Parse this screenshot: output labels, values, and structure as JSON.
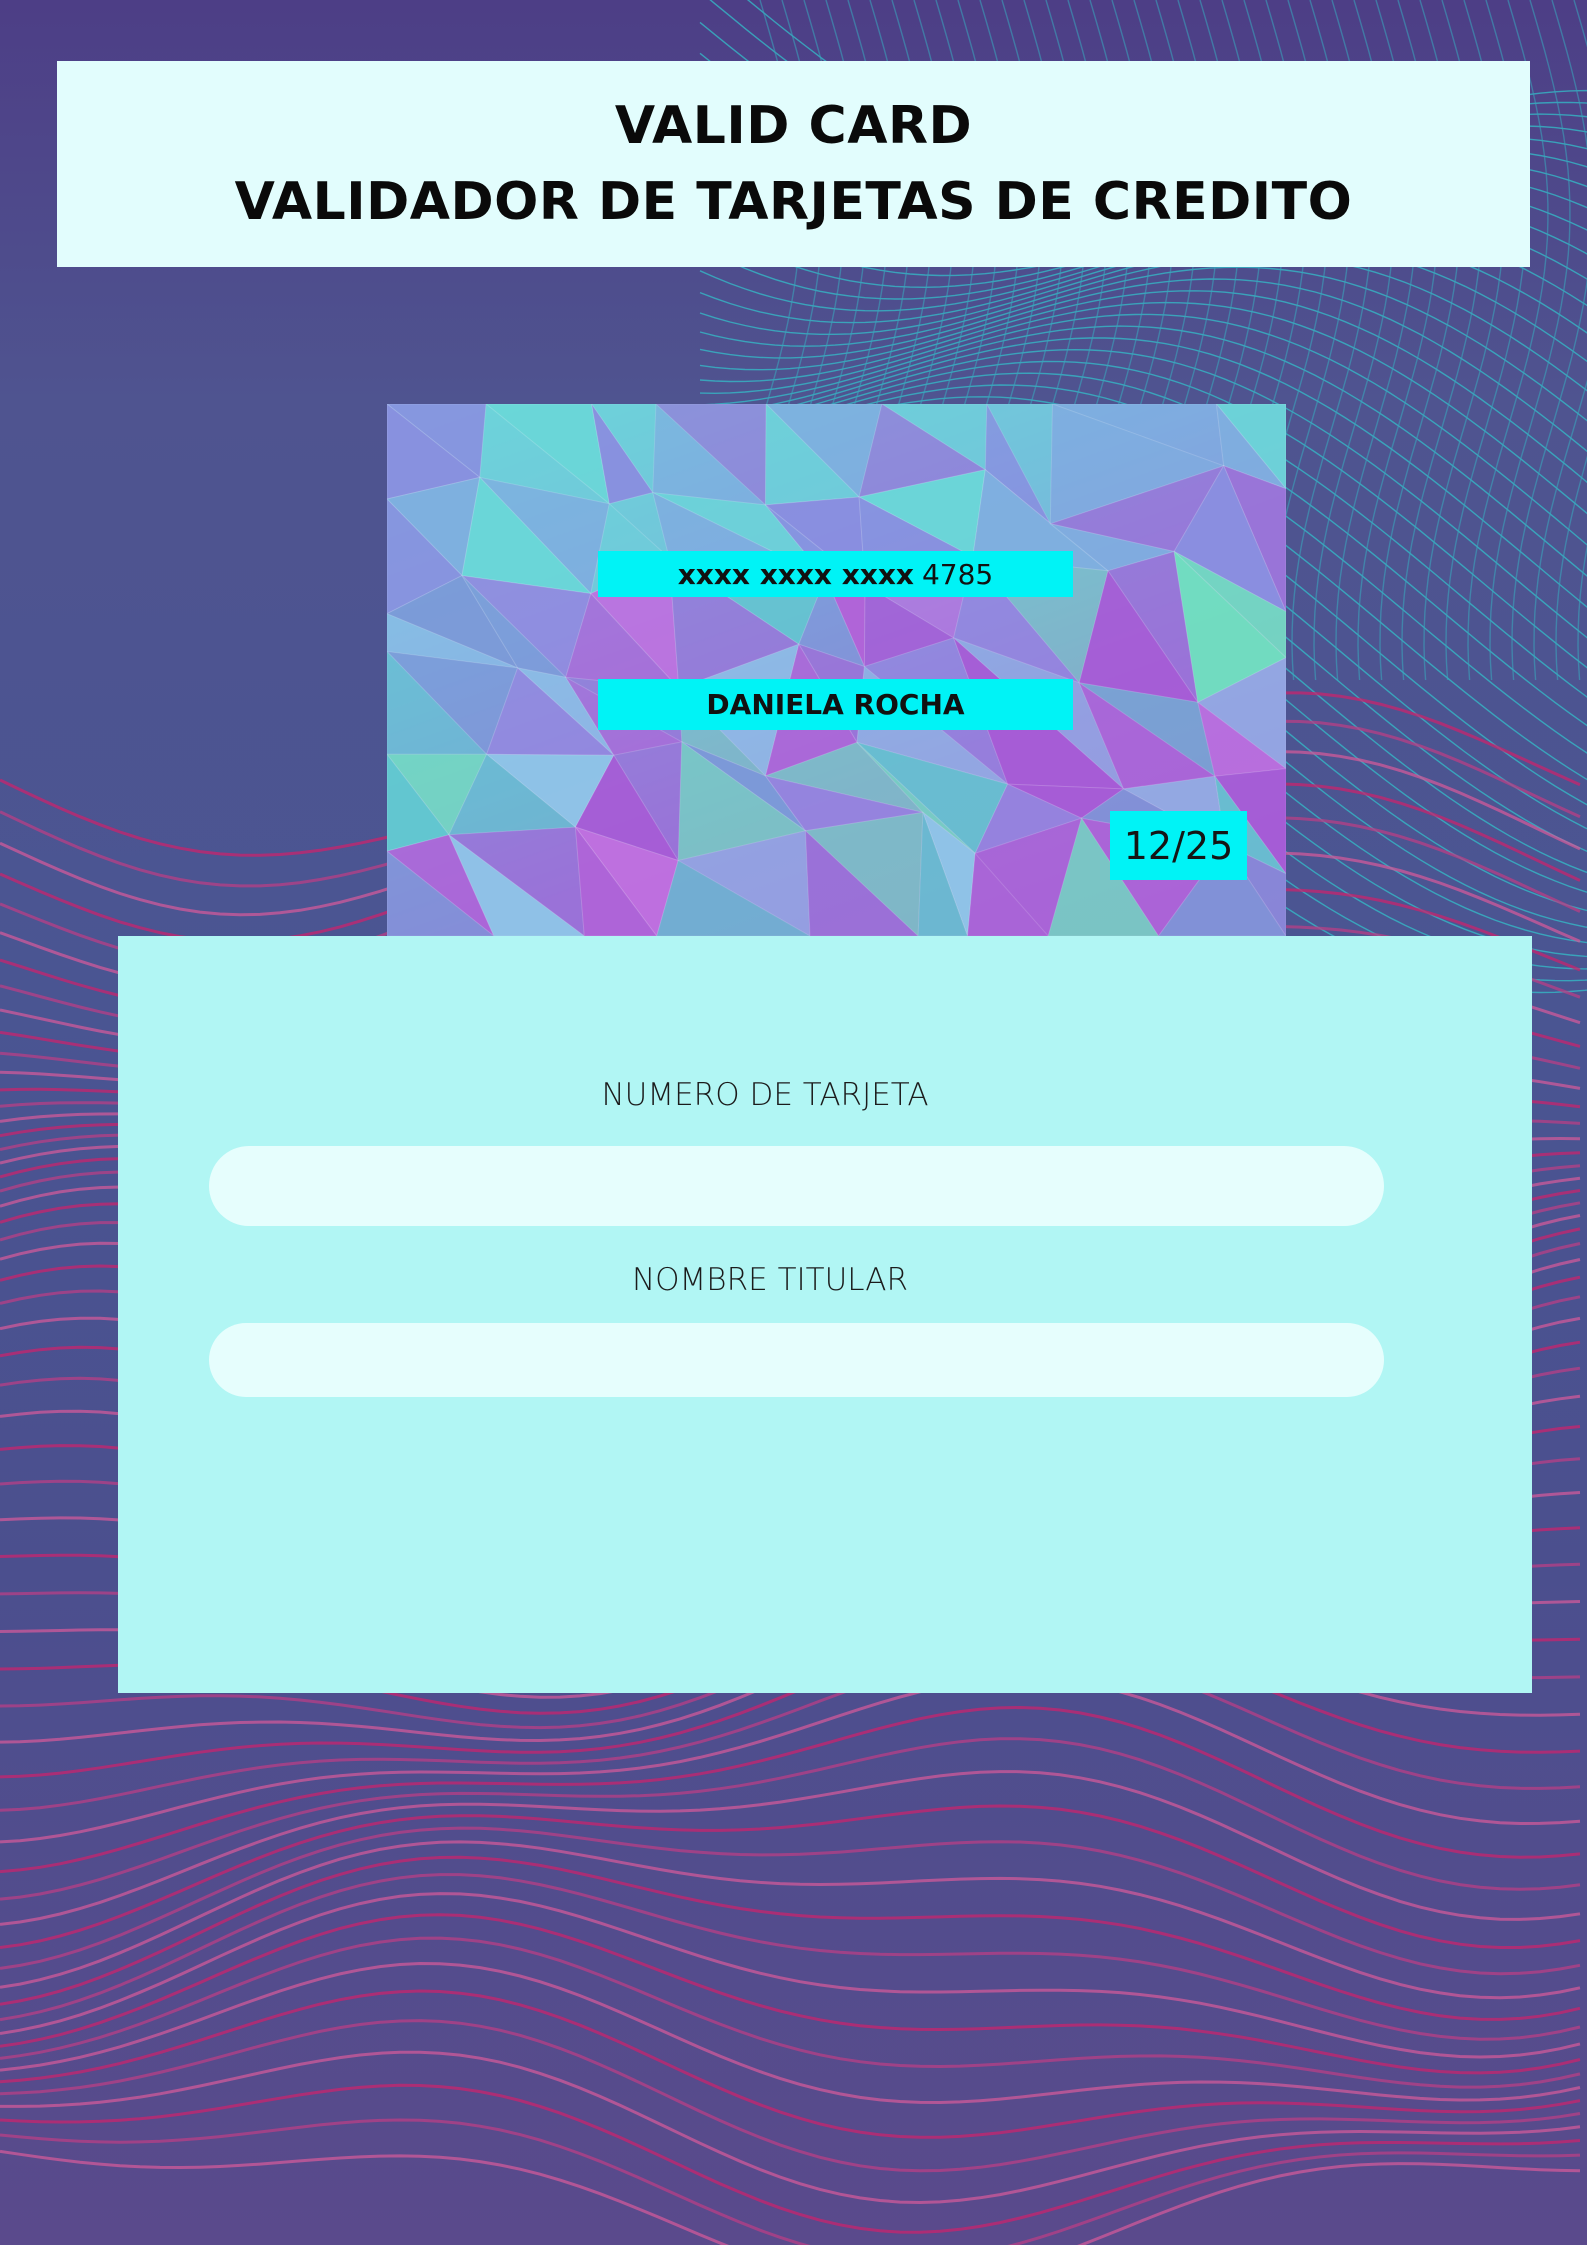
{
  "header": {
    "line1": "VALID CARD",
    "line2": "VALIDADOR DE TARJETAS DE CREDITO"
  },
  "card": {
    "number_masked": "xxxx xxxx xxxx",
    "number_last4": "4785",
    "holder": "DANIELA ROCHA",
    "expiry": "12/25"
  },
  "form": {
    "card_number_label": "NUMERO DE TARJETA",
    "card_number_value": "",
    "holder_label": "NOMBRE TITULAR",
    "holder_value": ""
  },
  "colors": {
    "background": "#4a5592",
    "header_bg": "#e2fdfd",
    "card_field_bg": "#00f3f6",
    "form_panel_bg": "#b1f6f4",
    "input_bg": "#e6fefd",
    "wave_pink": "#c8246e",
    "mesh_teal": "#2fb8c8"
  }
}
